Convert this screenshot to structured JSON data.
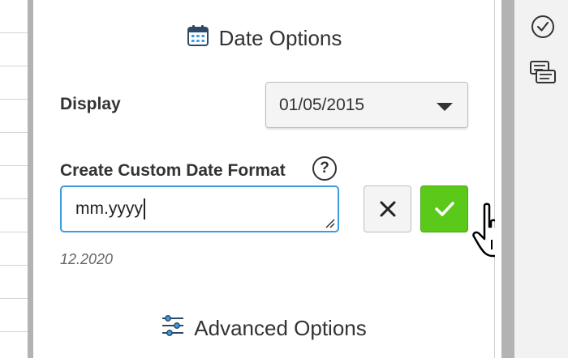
{
  "date_options": {
    "title": "Date Options",
    "display_label": "Display",
    "display_value": "01/05/2015",
    "custom_format_label": "Create Custom Date Format",
    "help_symbol": "?",
    "custom_format_value": "mm.yyyy",
    "preview": "12.2020"
  },
  "advanced": {
    "title": "Advanced Options"
  },
  "icons": {
    "title_icon": "calendar-icon",
    "advanced_icon": "sliders-icon",
    "cancel_icon": "close-icon",
    "confirm_icon": "check-icon",
    "rail_icons": [
      "check-circle-icon",
      "comments-icon"
    ],
    "cursor": "hand-pointer-icon"
  },
  "colors": {
    "accent_blue": "#3b9be0",
    "confirm_green": "#5bc91a",
    "text": "#333333"
  }
}
